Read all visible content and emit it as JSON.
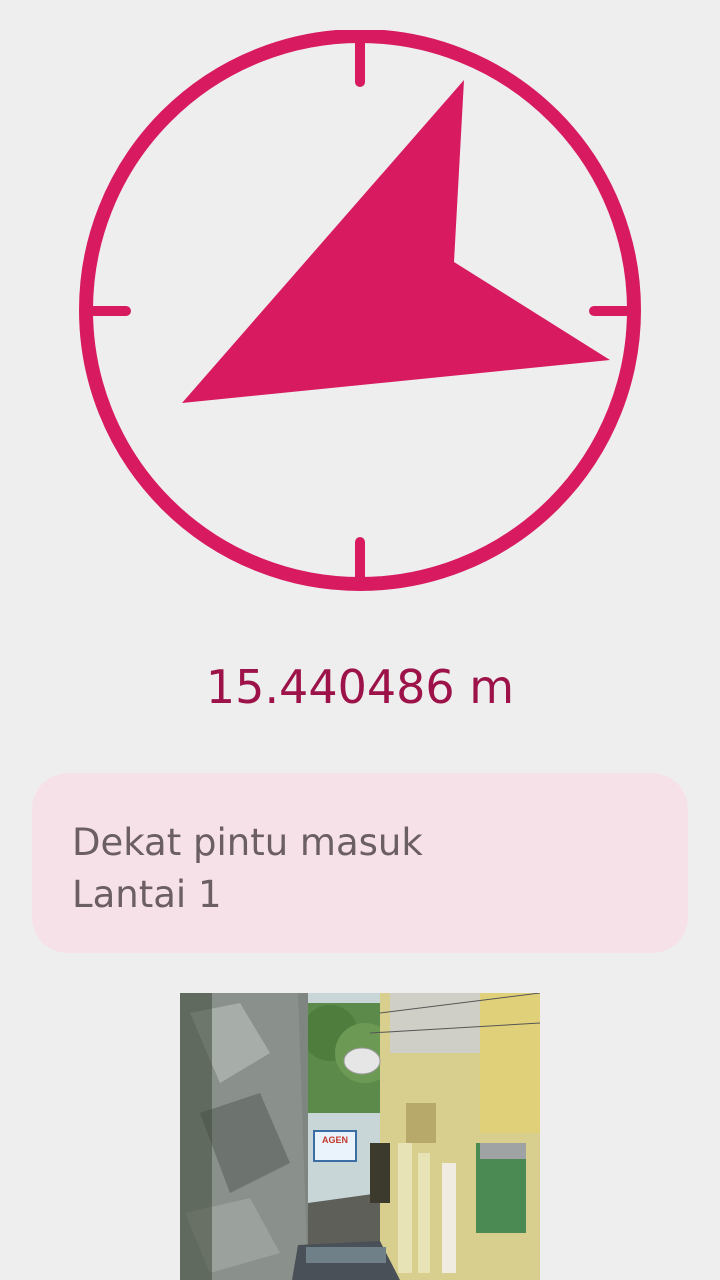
{
  "navigator": {
    "icon": "direction-arrow-icon",
    "accent_color": "#d81b60",
    "bearing_degrees": 60
  },
  "distance": {
    "text": "15.440486 m",
    "color": "#9c1249"
  },
  "location": {
    "description": "Dekat pintu masuk",
    "floor": "Lantai 1"
  },
  "photo": {
    "sign_text": "AGEN"
  }
}
